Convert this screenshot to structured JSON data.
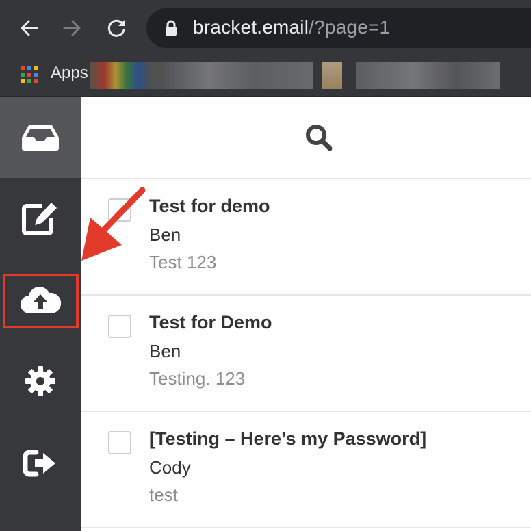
{
  "browser": {
    "url_host": "bracket.email",
    "url_path": "/?page=1",
    "bookmarks_label": "Apps",
    "colors": {
      "chrome": "#35363a",
      "url_box": "#202124"
    }
  },
  "sidebar": {
    "items": [
      {
        "name": "inbox",
        "icon": "inbox-icon",
        "active": true
      },
      {
        "name": "compose",
        "icon": "edit-icon"
      },
      {
        "name": "upload",
        "icon": "cloud-upload-icon",
        "highlighted": true
      },
      {
        "name": "settings",
        "icon": "gear-icon"
      },
      {
        "name": "logout",
        "icon": "sign-out-icon"
      }
    ],
    "colors": {
      "background": "#37383b",
      "active": "#55565a",
      "highlight": "#e33b2b"
    }
  },
  "search": {
    "icon": "search-icon"
  },
  "emails": [
    {
      "subject": "Test for demo",
      "sender": "Ben",
      "preview": "Test 123"
    },
    {
      "subject": "Test for Demo",
      "sender": "Ben",
      "preview": "Testing. 123"
    },
    {
      "subject": "[Testing – Here’s my Password]",
      "sender": "Cody",
      "preview": "test"
    }
  ],
  "annotation": {
    "arrow_color": "#e33b2b"
  }
}
